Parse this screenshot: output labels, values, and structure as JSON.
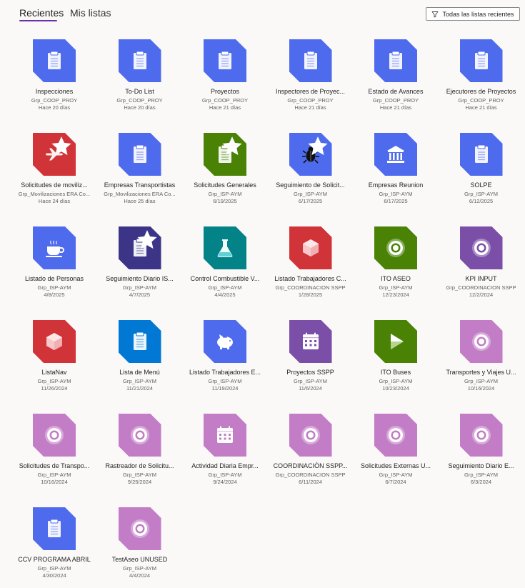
{
  "tabs": {
    "recent": "Recientes",
    "my_lists": "Mis listas"
  },
  "filter": {
    "label": "Todas las listas recientes"
  },
  "colors": {
    "blue": "#4f6bed",
    "red": "#d13438",
    "green": "#498205",
    "purple": "#5c2e91",
    "darkpurple": "#3c3487",
    "teal": "#038387",
    "lightblue": "#0078d4",
    "pink": "#c27dc6",
    "violet": "#7b4fa8",
    "accent": "#6b2fa8"
  },
  "items": [
    {
      "name": "Inspecciones",
      "owner": "Grp_COOP_PROY",
      "date": "Hace 20 días",
      "color": "blue",
      "icon": "clipboard-icon",
      "star": false
    },
    {
      "name": "To-Do List",
      "owner": "Grp_COOP_PROY",
      "date": "Hace 20 días",
      "color": "blue",
      "icon": "clipboard-icon",
      "star": false
    },
    {
      "name": "Proyectos",
      "owner": "Grp_COOP_PROY",
      "date": "Hace 21 días",
      "color": "blue",
      "icon": "clipboard-icon",
      "star": false
    },
    {
      "name": "Inspectores de Proyec...",
      "owner": "Grp_COOP_PROY",
      "date": "Hace 21 días",
      "color": "blue",
      "icon": "clipboard-icon",
      "star": false
    },
    {
      "name": "Estado de Avances",
      "owner": "Grp_COOP_PROY",
      "date": "Hace 21 días",
      "color": "blue",
      "icon": "clipboard-icon",
      "star": false
    },
    {
      "name": "Ejecutores de Proyectos",
      "owner": "Grp_COOP_PROY",
      "date": "Hace 21 días",
      "color": "blue",
      "icon": "clipboard-icon",
      "star": false
    },
    {
      "name": "Solicitudes de moviliz...",
      "owner": "Grp_Movilizaciones ERA Co...",
      "date": "Hace 24 días",
      "color": "red",
      "icon": "airplane-icon",
      "star": true
    },
    {
      "name": "Empresas Transportistas",
      "owner": "Grp_Movilizaciones ERA Co...",
      "date": "Hace 25 días",
      "color": "blue",
      "icon": "clipboard-icon",
      "star": false
    },
    {
      "name": "Solicitudes Generales",
      "owner": "Grp_ISP-AYM",
      "date": "6/19/2025",
      "color": "green",
      "icon": "clipboard-icon",
      "star": true
    },
    {
      "name": "Seguimiento de Solicit...",
      "owner": "Grp_ISP-AYM",
      "date": "6/17/2025",
      "color": "blue",
      "icon": "bug-icon",
      "star": true
    },
    {
      "name": "Empresas Reunion",
      "owner": "Grp_ISP-AYM",
      "date": "6/17/2025",
      "color": "blue",
      "icon": "bank-icon",
      "star": false
    },
    {
      "name": "SOLPE",
      "owner": "Grp_ISP-AYM",
      "date": "6/12/2025",
      "color": "blue",
      "icon": "clipboard-icon",
      "star": false
    },
    {
      "name": "Listado de Personas",
      "owner": "Grp_ISP-AYM",
      "date": "4/8/2025",
      "color": "blue",
      "icon": "coffee-icon",
      "star": false
    },
    {
      "name": "Seguimiento Diario IS...",
      "owner": "Grp_ISP-AYM",
      "date": "4/7/2025",
      "color": "darkpurple",
      "icon": "clipboard-icon",
      "star": true
    },
    {
      "name": "Control Combustible V...",
      "owner": "Grp_ISP-AYM",
      "date": "4/4/2025",
      "color": "teal",
      "icon": "flask-icon",
      "star": false
    },
    {
      "name": "Listado Trabajadores C...",
      "owner": "Grp_COORDINACION SSPP",
      "date": "1/28/2025",
      "color": "red",
      "icon": "cube-icon",
      "star": false
    },
    {
      "name": "ITO ASEO",
      "owner": "Grp_ISP-AYM",
      "date": "12/23/2024",
      "color": "green",
      "icon": "target-icon",
      "star": false
    },
    {
      "name": "KPI INPUT",
      "owner": "Grp_COORDINACION SSPP",
      "date": "12/2/2024",
      "color": "violet",
      "icon": "target-icon",
      "star": false
    },
    {
      "name": "ListaNav",
      "owner": "Grp_ISP-AYM",
      "date": "11/26/2024",
      "color": "red",
      "icon": "cube-icon",
      "star": false
    },
    {
      "name": "Lista de Menú",
      "owner": "Grp_ISP-AYM",
      "date": "11/21/2024",
      "color": "lightblue",
      "icon": "clipboard-icon",
      "star": false
    },
    {
      "name": "Listado Trabajadores E...",
      "owner": "Grp_ISP-AYM",
      "date": "11/19/2024",
      "color": "blue",
      "icon": "piggy-bank-icon",
      "star": false
    },
    {
      "name": "Proyectos SSPP",
      "owner": "Grp_ISP-AYM",
      "date": "11/6/2024",
      "color": "violet",
      "icon": "calendar-icon",
      "star": false
    },
    {
      "name": "ITO Buses",
      "owner": "Grp_ISP-AYM",
      "date": "10/23/2024",
      "color": "green",
      "icon": "play-icon",
      "star": false
    },
    {
      "name": "Transportes y Viajes U...",
      "owner": "Grp_ISP-AYM",
      "date": "10/16/2024",
      "color": "pink",
      "icon": "target-icon",
      "star": false
    },
    {
      "name": "Solicitudes de Transpo...",
      "owner": "Grp_ISP-AYM",
      "date": "10/16/2024",
      "color": "pink",
      "icon": "target-icon",
      "star": false
    },
    {
      "name": "Rastreador de Solicitu...",
      "owner": "Grp_ISP-AYM",
      "date": "9/25/2024",
      "color": "pink",
      "icon": "target-icon",
      "star": false
    },
    {
      "name": "Actividad Diaria Empr...",
      "owner": "Grp_ISP-AYM",
      "date": "9/24/2024",
      "color": "pink",
      "icon": "calendar-icon",
      "star": false
    },
    {
      "name": "COORDINACIÓN SSPP...",
      "owner": "Grp_COORDINACION SSPP",
      "date": "6/11/2024",
      "color": "pink",
      "icon": "target-icon",
      "star": false
    },
    {
      "name": "Solicitudes Externas U...",
      "owner": "Grp_ISP-AYM",
      "date": "6/7/2024",
      "color": "pink",
      "icon": "target-icon",
      "star": false
    },
    {
      "name": "Seguimiento Diario E...",
      "owner": "Grp_ISP-AYM",
      "date": "6/3/2024",
      "color": "pink",
      "icon": "target-icon",
      "star": false
    },
    {
      "name": "CCV PROGRAMA ABRIL",
      "owner": "Grp_ISP-AYM",
      "date": "4/30/2024",
      "color": "blue",
      "icon": "clipboard-icon",
      "star": false
    },
    {
      "name": "TestAseo UNUSED",
      "owner": "Grp_ISP-AYM",
      "date": "4/4/2024",
      "color": "pink",
      "icon": "target-icon",
      "star": false
    }
  ]
}
